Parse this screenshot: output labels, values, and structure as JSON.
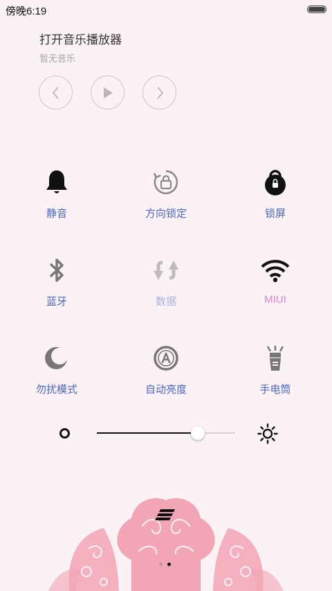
{
  "status_bar": {
    "time": "傍晚6:19",
    "battery_level": 1.0
  },
  "music": {
    "title": "打开音乐播放器",
    "subtitle": "暂无音乐",
    "controls": [
      {
        "icon": "chevron-left-icon"
      },
      {
        "icon": "play-icon"
      },
      {
        "icon": "chevron-right-icon"
      }
    ]
  },
  "toggles": [
    {
      "icon": "bell-icon",
      "label": "静音",
      "state": "on"
    },
    {
      "icon": "rotation-lock-icon",
      "label": "方向锁定",
      "state": "off"
    },
    {
      "icon": "lock-icon",
      "label": "锁屏",
      "state": "on"
    },
    {
      "icon": "bluetooth-icon",
      "label": "蓝牙",
      "state": "off"
    },
    {
      "icon": "data-sync-icon",
      "label": "数据",
      "state": "disabled"
    },
    {
      "icon": "wifi-icon",
      "label": "MIUI",
      "state": "on"
    },
    {
      "icon": "moon-icon",
      "label": "勿扰模式",
      "state": "off"
    },
    {
      "icon": "auto-brightness-icon",
      "label": "自动亮度",
      "state": "off"
    },
    {
      "icon": "flashlight-icon",
      "label": "手电筒",
      "state": "off"
    }
  ],
  "brightness": {
    "level": 0.73
  },
  "pager": {
    "count": 2,
    "active_index": 1
  },
  "colors": {
    "background": "#faf2f4",
    "label": "#4c67c9",
    "label_disabled": "#a9b4e2",
    "wifi_label": "#f07cc4",
    "icon_on": "#111111",
    "icon_off": "#777777",
    "decor_pink": "#f2a5b4"
  }
}
